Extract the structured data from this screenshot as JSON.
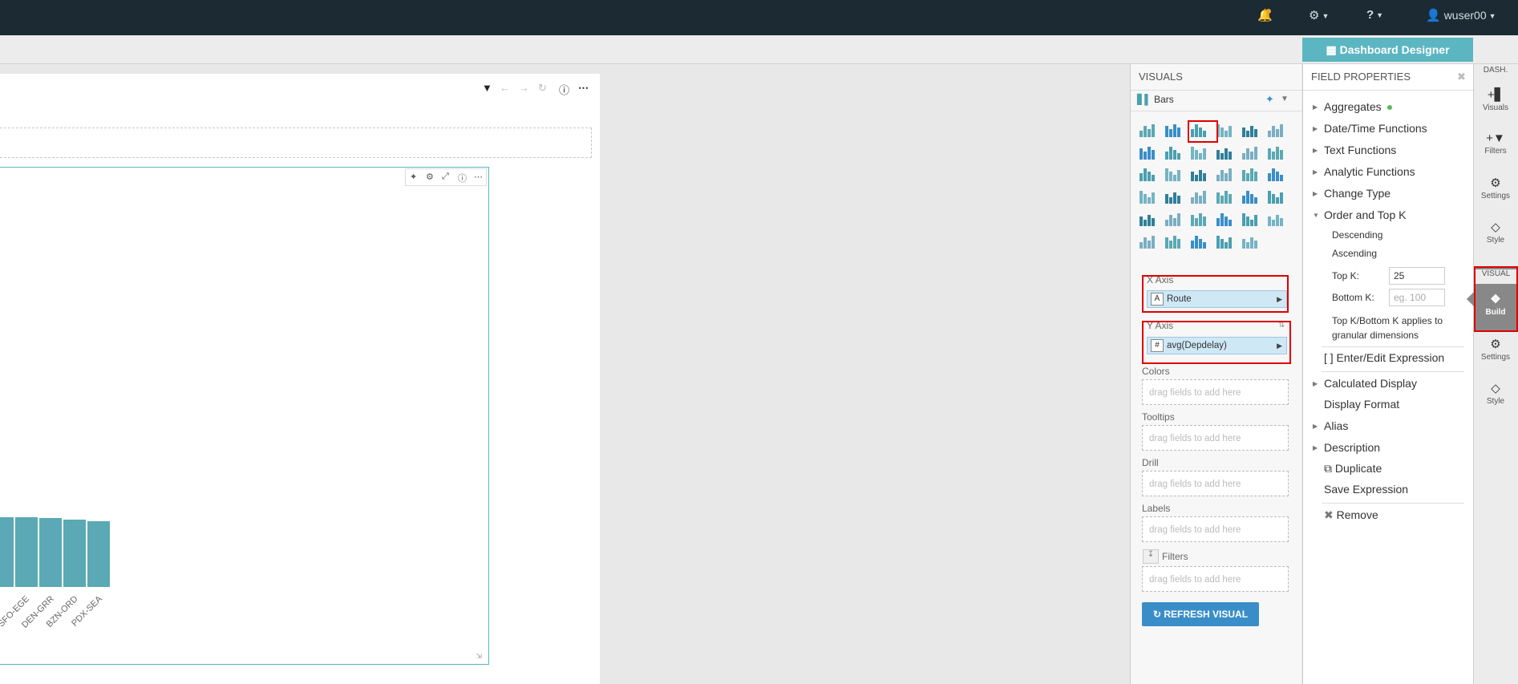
{
  "topbar": {
    "user": "wuser00",
    "bell_icon": "bell-icon",
    "settings_icon": "gear-icon",
    "help_icon": "help-icon"
  },
  "dashboard_designer": {
    "label": "Dashboard Designer"
  },
  "chart_data": {
    "type": "bar",
    "categories": [
      "SFO-EGE",
      "DEN-GRR",
      "BZN-ORD",
      "PDX-SEA"
    ],
    "values": [
      null,
      null,
      null,
      null
    ],
    "xlabel": "",
    "ylabel": ""
  },
  "visuals": {
    "heading": "VISUALS",
    "selected_type": "Bars",
    "shelves": {
      "x_axis": {
        "label": "X Axis",
        "field": "Route",
        "field_tag": "A"
      },
      "y_axis": {
        "label": "Y Axis",
        "field": "avg(Depdelay)",
        "field_tag": "#"
      },
      "colors": {
        "label": "Colors",
        "placeholder": "drag fields to add here"
      },
      "tooltips": {
        "label": "Tooltips",
        "placeholder": "drag fields to add here"
      },
      "drill": {
        "label": "Drill",
        "placeholder": "drag fields to add here"
      },
      "labels": {
        "label": "Labels",
        "placeholder": "drag fields to add here"
      },
      "filters": {
        "label": "Filters",
        "placeholder": "drag fields to add here"
      }
    },
    "refresh_label": "REFRESH VISUAL"
  },
  "field_properties": {
    "heading": "FIELD PROPERTIES",
    "aggregates": "Aggregates",
    "datetime": "Date/Time Functions",
    "text_functions": "Text Functions",
    "analytic_functions": "Analytic Functions",
    "change_type": "Change Type",
    "order_topk": "Order and Top K",
    "descending": "Descending",
    "ascending": "Ascending",
    "topk_label": "Top K:",
    "topk_value": "25",
    "bottomk_label": "Bottom K:",
    "bottomk_placeholder": "eg. 100",
    "topk_note": "Top K/Bottom K applies to granular dimensions",
    "enter_edit": "[ ] Enter/Edit Expression",
    "calculated_display": "Calculated Display",
    "display_format": "Display Format",
    "alias": "Alias",
    "description": "Description",
    "duplicate": "Duplicate",
    "save_expression": "Save Expression",
    "remove": "Remove"
  },
  "rail": {
    "dash_label": "DASH.",
    "visuals": "Visuals",
    "filters": "Filters",
    "settings": "Settings",
    "style": "Style",
    "visual_label": "VISUAL",
    "build": "Build",
    "settings2": "Settings",
    "style2": "Style"
  }
}
